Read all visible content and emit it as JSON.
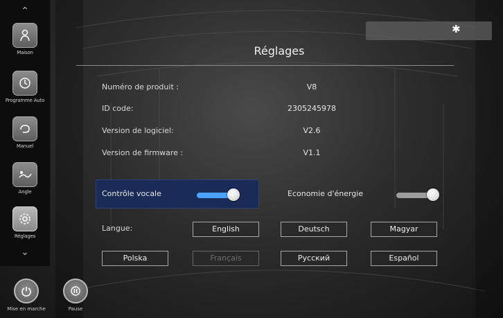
{
  "sidebar": {
    "items": [
      {
        "label": "Maison",
        "icon": "person-relax-icon"
      },
      {
        "label": "Programme Auto",
        "icon": "auto-program-icon"
      },
      {
        "label": "Manuel",
        "icon": "hand-icon"
      },
      {
        "label": "Angle",
        "icon": "recline-icon"
      },
      {
        "label": "Réglages",
        "icon": "gear-icon"
      }
    ],
    "active": "Réglages"
  },
  "footer": {
    "power_label": "Mise en marche",
    "pause_label": "Pause"
  },
  "status": {
    "bluetooth_icon": "bluetooth-icon"
  },
  "page": {
    "title": "Réglages",
    "info": [
      {
        "label": "Numéro de produit :",
        "value": "V8"
      },
      {
        "label": "ID code:",
        "value": "2305245978"
      },
      {
        "label": "Version de logiciel:",
        "value": "V2.6"
      },
      {
        "label": "Version de firmware :",
        "value": "V1.1"
      }
    ],
    "voice_control": {
      "label": "Contrôle vocale",
      "on": true
    },
    "energy_saving": {
      "label": "Economie d'énergie",
      "on": true
    },
    "language": {
      "label": "Langue:",
      "options": [
        "English",
        "Deutsch",
        "Magyar",
        "Polska",
        "Français",
        "Русский",
        "Español"
      ],
      "selected": "Français"
    }
  },
  "colors": {
    "accent": "#4aa3ff",
    "highlight": "#1b2b57"
  }
}
